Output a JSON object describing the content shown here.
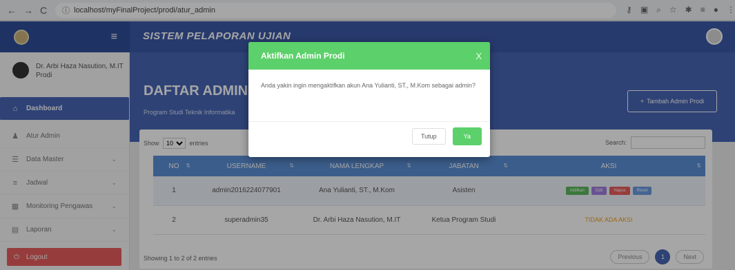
{
  "browser": {
    "url": "localhost/myFinalProject/prodi/atur_admin"
  },
  "app": {
    "title": "SISTEM PELAPORAN UJIAN"
  },
  "sidebar": {
    "user_name": "Dr. Arbi Haza Nasution, M.IT",
    "user_role": "Prodi",
    "items": [
      {
        "label": "Dashboard",
        "icon": "home-icon"
      },
      {
        "label": "Atur Admin",
        "icon": "user-icon"
      },
      {
        "label": "Data Master",
        "icon": "database-icon"
      },
      {
        "label": "Jadwal",
        "icon": "list-icon"
      },
      {
        "label": "Monitoring Pengawas",
        "icon": "grid-icon"
      },
      {
        "label": "Laporan",
        "icon": "file-icon"
      }
    ],
    "logout": "Logout"
  },
  "page": {
    "title": "DAFTAR ADMIN PRODI",
    "subtitle": "Program Studi Teknik Informatika",
    "add_button": "Tambah Admin Prodi"
  },
  "table": {
    "show_label": "Show",
    "entries_value": "10",
    "entries_label": "entries",
    "search_label": "Search:",
    "headers": [
      "NO",
      "USERNAME",
      "NAMA LENGKAP",
      "JABATAN",
      "AKSI"
    ],
    "rows": [
      {
        "no": "1",
        "username": "admin2016224077901",
        "name": "Ana Yulianti, ST., M.Kom",
        "jabatan": "Asisten"
      },
      {
        "no": "2",
        "username": "superadmin35",
        "name": "Dr. Arbi Haza Nasution, M.IT",
        "jabatan": "Ketua Program Studi",
        "aksi_text": "TIDAK ADA AKSI"
      }
    ],
    "actions": [
      "Aktifkan",
      "Edit",
      "Hapus",
      "Reset"
    ],
    "info": "Showing 1 to 2 of 2 entries",
    "prev": "Previous",
    "page": "1",
    "next": "Next"
  },
  "modal": {
    "title": "Aktifkan Admin Prodi",
    "close": "X",
    "message": "Anda yakin ingin mengaktifkan akun Ana Yulianti, ST., M.Kom sebagai admin?",
    "cancel": "Tutup",
    "confirm": "Ya"
  },
  "colors": {
    "primary": "#4766b5",
    "success": "#5cd06a",
    "danger": "#e85c5c",
    "warning": "#f0a020"
  }
}
